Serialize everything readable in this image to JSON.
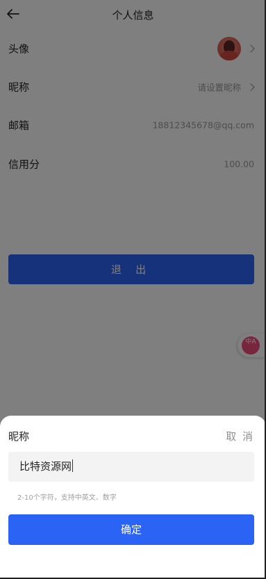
{
  "header": {
    "title": "个人信息",
    "back_icon": "back-arrow-icon"
  },
  "rows": [
    {
      "label": "头像",
      "value": "",
      "has_chevron": true,
      "type": "avatar"
    },
    {
      "label": "昵称",
      "value": "请设置昵称",
      "has_chevron": true
    },
    {
      "label": "邮箱",
      "value": "18812345678@qq.com",
      "has_chevron": false
    },
    {
      "label": "信用分",
      "value": "100.00",
      "has_chevron": false
    }
  ],
  "logout_label": "退 出",
  "translate_badge": {
    "icon": "translate-icon",
    "text": "中A"
  },
  "sheet": {
    "title": "昵称",
    "cancel_label": "取 消",
    "input_value": "比特资源网",
    "hint": "2-10个字符，支持中英文、数字",
    "confirm_label": "确定"
  },
  "colors": {
    "primary": "#2b64f5",
    "mask": "rgba(0,0,0,0.5)",
    "badge": "#f04a7d"
  }
}
